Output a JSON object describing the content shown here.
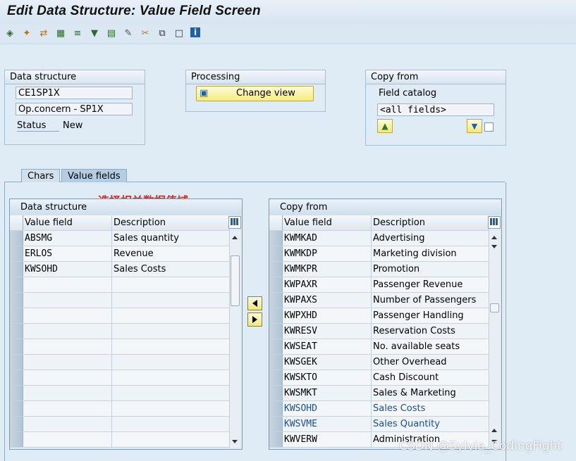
{
  "window": {
    "title": "Edit Data Structure: Value Field Screen"
  },
  "toolbar": {
    "icons": [
      "hierarchy-icon",
      "magic-wand-icon",
      "transfer-icon",
      "select-block-icon",
      "align-icon",
      "filter-icon",
      "detail-icon",
      "edit-icon",
      "cut-icon",
      "copy-icon",
      "new-document-icon",
      "info-icon"
    ]
  },
  "data_structure": {
    "title": "Data structure",
    "name": "CE1SP1X",
    "description": "Op.concern - SP1X",
    "status_label": "Status",
    "status_value": "New"
  },
  "processing": {
    "title": "Processing",
    "change_view_label": "Change view"
  },
  "copy_from_box": {
    "title": "Copy from",
    "catalog_label": "Field catalog",
    "catalog_value": "<all fields>"
  },
  "tabs": [
    {
      "label": "Chars",
      "active": false
    },
    {
      "label": "Value fields",
      "active": true
    }
  ],
  "annotation": {
    "text": "选择相关数据值域",
    "color": "#e8261d"
  },
  "left_table": {
    "title": "Data structure",
    "columns": [
      "Value field",
      "Description"
    ],
    "rows": [
      {
        "field": "ABSMG",
        "description": "Sales quantity"
      },
      {
        "field": "ERLOS",
        "description": "Revenue"
      },
      {
        "field": "KWSOHD",
        "description": "Sales Costs"
      },
      {
        "field": "",
        "description": ""
      },
      {
        "field": "",
        "description": ""
      },
      {
        "field": "",
        "description": ""
      },
      {
        "field": "",
        "description": ""
      },
      {
        "field": "",
        "description": ""
      },
      {
        "field": "",
        "description": ""
      },
      {
        "field": "",
        "description": ""
      },
      {
        "field": "",
        "description": ""
      },
      {
        "field": "",
        "description": ""
      },
      {
        "field": "",
        "description": ""
      },
      {
        "field": "",
        "description": ""
      }
    ]
  },
  "right_table": {
    "title": "Copy from",
    "columns": [
      "Value field",
      "Description"
    ],
    "rows": [
      {
        "field": "KWMKAD",
        "description": "Advertising"
      },
      {
        "field": "KWMKDP",
        "description": "Marketing division"
      },
      {
        "field": "KWMKPR",
        "description": "Promotion"
      },
      {
        "field": "KWPAXR",
        "description": "Passenger Revenue"
      },
      {
        "field": "KWPAXS",
        "description": "Number of Passengers"
      },
      {
        "field": "KWPXHD",
        "description": "Passenger Handling"
      },
      {
        "field": "KWRESV",
        "description": "Reservation Costs"
      },
      {
        "field": "KWSEAT",
        "description": "No. available seats"
      },
      {
        "field": "KWSGEK",
        "description": "Other Overhead"
      },
      {
        "field": "KWSKTO",
        "description": "Cash Discount"
      },
      {
        "field": "KWSMKT",
        "description": "Sales & Marketing"
      },
      {
        "field": "KWSOHD",
        "description": "Sales Costs",
        "highlight": true
      },
      {
        "field": "KWSVME",
        "description": "Sales Quantity",
        "highlight": true
      },
      {
        "field": "KWVERW",
        "description": "Administration"
      }
    ]
  },
  "watermark": "CSDN @Sylvia_CodingFight"
}
